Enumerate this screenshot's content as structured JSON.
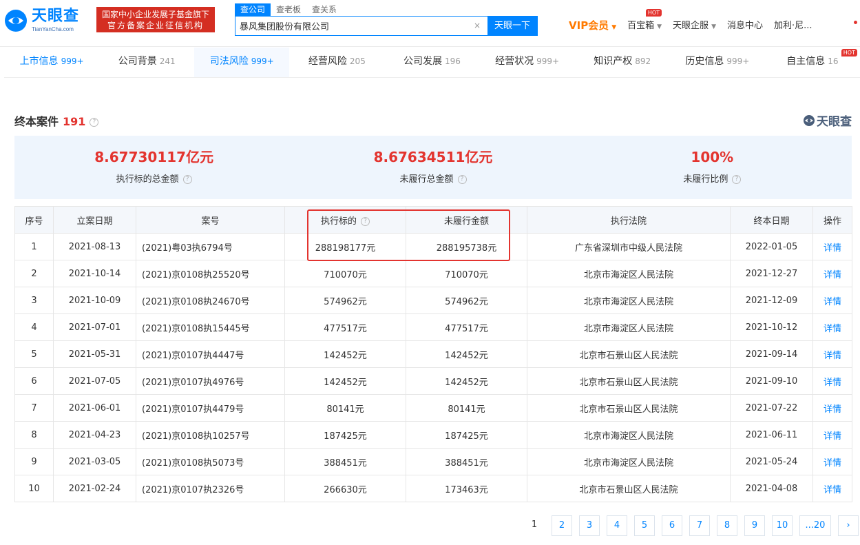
{
  "header": {
    "logo_text": "天眼查",
    "logo_sub": "TianYanCha.com",
    "badge_line1": "国家中小企业发展子基金旗下",
    "badge_line2": "官方备案企业征信机构",
    "search_tabs": [
      "查公司",
      "查老板",
      "查关系"
    ],
    "search_value": "暴风集团股份有限公司",
    "search_clear": "×",
    "search_button": "天眼一下",
    "nav": {
      "vip": "VIP会员",
      "treasure": "百宝箱",
      "treasure_hot": "HOT",
      "enterprise": "天眼企服",
      "messages": "消息中心",
      "user": "加利·尼..."
    }
  },
  "section_tabs": [
    {
      "label": "上市信息",
      "count": "999+"
    },
    {
      "label": "公司背景",
      "count": "241"
    },
    {
      "label": "司法风险",
      "count": "999+"
    },
    {
      "label": "经营风险",
      "count": "205"
    },
    {
      "label": "公司发展",
      "count": "196"
    },
    {
      "label": "经营状况",
      "count": "999+"
    },
    {
      "label": "知识产权",
      "count": "892"
    },
    {
      "label": "历史信息",
      "count": "999+"
    },
    {
      "label": "自主信息",
      "count": "16",
      "hot": "HOT"
    }
  ],
  "section": {
    "title": "终本案件",
    "total": "191",
    "help": "?",
    "watermark": "天眼查"
  },
  "summary": [
    {
      "value": "8.67730117亿元",
      "label": "执行标的总金额"
    },
    {
      "value": "8.67634511亿元",
      "label": "未履行总金额"
    },
    {
      "value": "100%",
      "label": "未履行比例"
    }
  ],
  "table": {
    "headers": [
      "序号",
      "立案日期",
      "案号",
      "执行标的",
      "未履行金额",
      "执行法院",
      "终本日期",
      "操作"
    ],
    "rows": [
      [
        "1",
        "2021-08-13",
        "(2021)粤03执6794号",
        "288198177元",
        "288195738元",
        "广东省深圳市中级人民法院",
        "2022-01-05",
        "详情"
      ],
      [
        "2",
        "2021-10-14",
        "(2021)京0108执25520号",
        "710070元",
        "710070元",
        "北京市海淀区人民法院",
        "2021-12-27",
        "详情"
      ],
      [
        "3",
        "2021-10-09",
        "(2021)京0108执24670号",
        "574962元",
        "574962元",
        "北京市海淀区人民法院",
        "2021-12-09",
        "详情"
      ],
      [
        "4",
        "2021-07-01",
        "(2021)京0108执15445号",
        "477517元",
        "477517元",
        "北京市海淀区人民法院",
        "2021-10-12",
        "详情"
      ],
      [
        "5",
        "2021-05-31",
        "(2021)京0107执4447号",
        "142452元",
        "142452元",
        "北京市石景山区人民法院",
        "2021-09-14",
        "详情"
      ],
      [
        "6",
        "2021-07-05",
        "(2021)京0107执4976号",
        "142452元",
        "142452元",
        "北京市石景山区人民法院",
        "2021-09-10",
        "详情"
      ],
      [
        "7",
        "2021-06-01",
        "(2021)京0107执4479号",
        "80141元",
        "80141元",
        "北京市石景山区人民法院",
        "2021-07-22",
        "详情"
      ],
      [
        "8",
        "2021-04-23",
        "(2021)京0108执10257号",
        "187425元",
        "187425元",
        "北京市海淀区人民法院",
        "2021-06-11",
        "详情"
      ],
      [
        "9",
        "2021-03-05",
        "(2021)京0108执5073号",
        "388451元",
        "388451元",
        "北京市海淀区人民法院",
        "2021-05-24",
        "详情"
      ],
      [
        "10",
        "2021-02-24",
        "(2021)京0107执2326号",
        "266630元",
        "173463元",
        "北京市石景山区人民法院",
        "2021-04-08",
        "详情"
      ]
    ]
  },
  "pagination": {
    "current": "1",
    "pages": [
      "2",
      "3",
      "4",
      "5",
      "6",
      "7",
      "8",
      "9",
      "10",
      "...20"
    ],
    "next": "›"
  },
  "colors": {
    "brand_blue": "#0084ff",
    "accent_red": "#e3342f",
    "vip_orange": "#ff7a00"
  }
}
